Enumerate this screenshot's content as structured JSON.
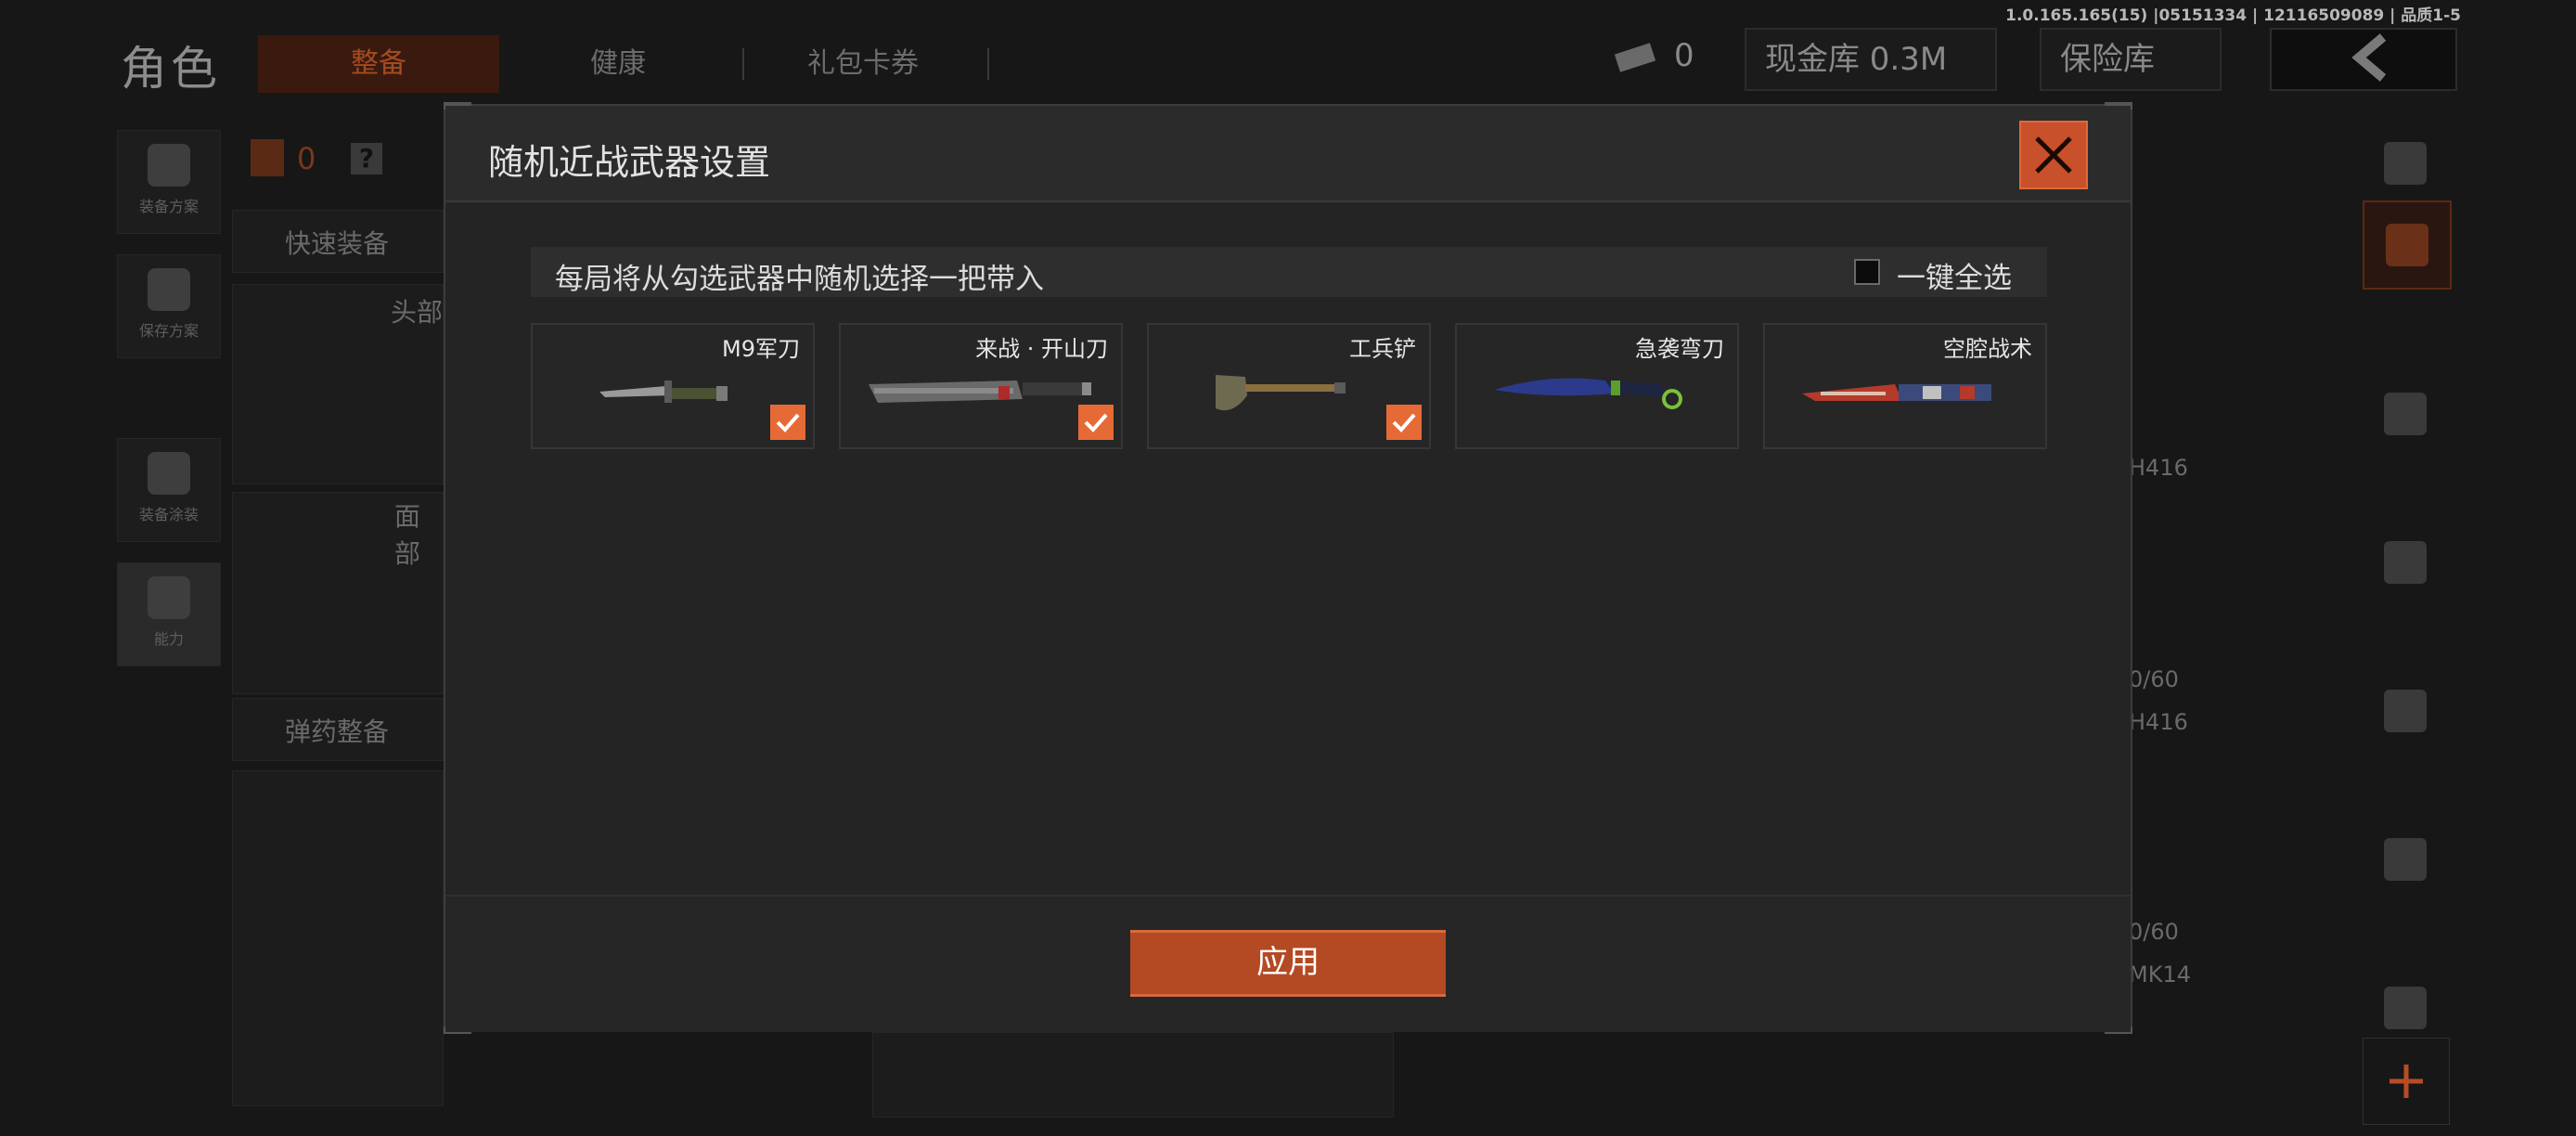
{
  "version": "1.0.165.165(15) |05151334 | 12116509089 | 品质1-5",
  "header": {
    "title": "角色",
    "tabs": [
      "整备",
      "健康",
      "礼包卡券"
    ],
    "currency": {
      "ticket_count": "0",
      "cash_label": "现金库 0.3M",
      "safe_label": "保险库"
    }
  },
  "left_panel": {
    "buttons": [
      "装备方案",
      "保存方案",
      "装备涂装",
      "能力"
    ],
    "armor_count": "0",
    "help": "?",
    "quick_equip": "快速装备",
    "slot_head": "头部",
    "slot_face": "面部",
    "ammo_label": "弹药整备"
  },
  "right_panel": {
    "weapon1": "H416",
    "ammo1": "0/60",
    "weapon2": "H416",
    "ammo2": "0/60",
    "weapon3": "MK14"
  },
  "modal": {
    "title": "随机近战武器设置",
    "info_text": "每局将从勾选武器中随机选择一把带入",
    "select_all_label": "一键全选",
    "select_all_checked": false,
    "apply_label": "应用",
    "accent_color": "#e66a36",
    "weapons": [
      {
        "name": "M9军刀",
        "checked": true,
        "icon": "bayonet-knife-icon"
      },
      {
        "name": "来战 · 开山刀",
        "checked": true,
        "icon": "machete-icon"
      },
      {
        "name": "工兵铲",
        "checked": true,
        "icon": "shovel-icon"
      },
      {
        "name": "急袭弯刀",
        "checked": false,
        "icon": "karambit-icon"
      },
      {
        "name": "空腔战术",
        "checked": false,
        "icon": "tactical-knife-icon"
      }
    ]
  }
}
